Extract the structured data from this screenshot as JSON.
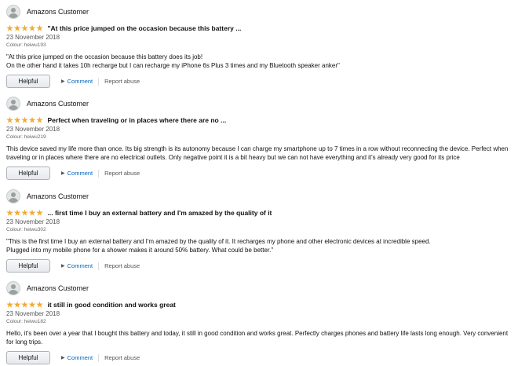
{
  "reviews": [
    {
      "author": "Amazons Customer",
      "title": "\"At this price jumped on the occasion because this battery ...",
      "date": "23 November 2018",
      "colour": "Colour: heiwu193",
      "body": "\"At this price jumped on the occasion because this battery does its job!\nOn the other hand it takes 10h recharge but I can recharge my iPhone 6s Plus 3 times and my Bluetooth speaker anker\"",
      "rating": 5
    },
    {
      "author": "Amazons Customer",
      "title": "Perfect when traveling or in places where there are no ...",
      "date": "23 November 2018",
      "colour": "Colour: heiwu219",
      "body": "This device saved my life more than once. Its big strength is its autonomy because I can charge my smartphone up to 7 times in a row without reconnecting the device. Perfect when traveling or in places where there are no electrical outlets. Only negative point it is a bit heavy but we can not have everything and it's already very good for its price",
      "rating": 5
    },
    {
      "author": "Amazons Customer",
      "title": "... first time I buy an external battery and I'm amazed by the quality of it",
      "date": "23 November 2018",
      "colour": "Colour: heiwu302",
      "body": "\"This is the first time I buy an external battery and I'm amazed by the quality of it. It recharges my phone and other electronic devices at incredible speed.\nPlugged into my mobile phone for a shower makes it around 50% battery. What could be better.\"",
      "rating": 5
    },
    {
      "author": "Amazons Customer",
      "title": "it still in good condition and works great",
      "date": "23 November 2018",
      "colour": "Colour: heiwu182",
      "body": "Hello, it's been over a year that I bought this battery and today, it still in good condition and works great. Perfectly charges phones and battery life lasts long enough. Very convenient for long trips.",
      "rating": 5
    }
  ],
  "actions": {
    "helpful": "Helpful",
    "comment": "Comment",
    "report": "Report abuse"
  },
  "colors": {
    "star": "#f2a933",
    "link": "#0066c0"
  }
}
